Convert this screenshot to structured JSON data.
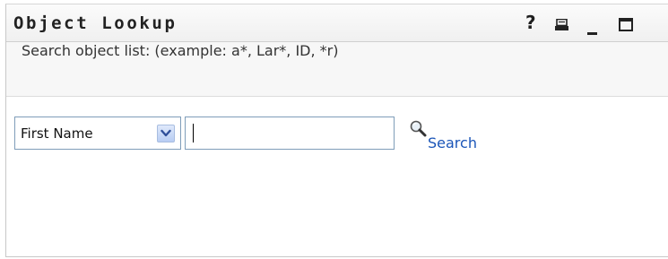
{
  "window": {
    "title": "Object Lookup",
    "help_label": "?"
  },
  "instruction": "Search object list: (example: a*, Lar*, ID, *r)",
  "search": {
    "field_select_value": "First Name",
    "input_value": "",
    "button_label": "Search"
  },
  "icons": {
    "help": "help-icon",
    "print": "print-icon",
    "minimize": "minimize-icon",
    "maximize": "maximize-icon",
    "search": "magnifier-icon",
    "dropdown": "chevron-down-icon"
  },
  "colors": {
    "link": "#1a55b8",
    "border": "#7f9db9",
    "dropdown_button": "#b8cdf3"
  }
}
